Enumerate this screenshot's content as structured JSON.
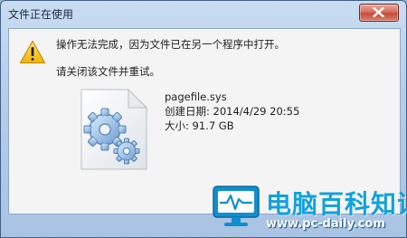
{
  "window": {
    "title": "文件正在使用",
    "close_icon": "close-icon"
  },
  "message": {
    "line1": "操作无法完成，因为文件已在另一个程序中打开。",
    "line2": "请关闭该文件并重试。",
    "icon": "warning-icon"
  },
  "file": {
    "icon": "system-file-gears-icon",
    "name": "pagefile.sys",
    "created": "创建日期: 2014/4/29 20:55",
    "size": "大小: 91.7 GB"
  },
  "watermark": {
    "title": "电脑百科知识",
    "url": "www.pc-daily.com",
    "icon": "monitor-logo-icon",
    "color": "#12a0de"
  }
}
